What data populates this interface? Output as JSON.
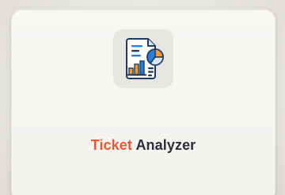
{
  "app_tile": {
    "icon": "ticket-report-icon",
    "title_part1": "Ticket",
    "title_part2": "Analyzer",
    "colors": {
      "accent": "#e8572f",
      "text": "#2a2f3a",
      "icon_blue": "#2a7fd4",
      "icon_orange": "#f29a2e",
      "icon_navy": "#1f3b63"
    }
  }
}
